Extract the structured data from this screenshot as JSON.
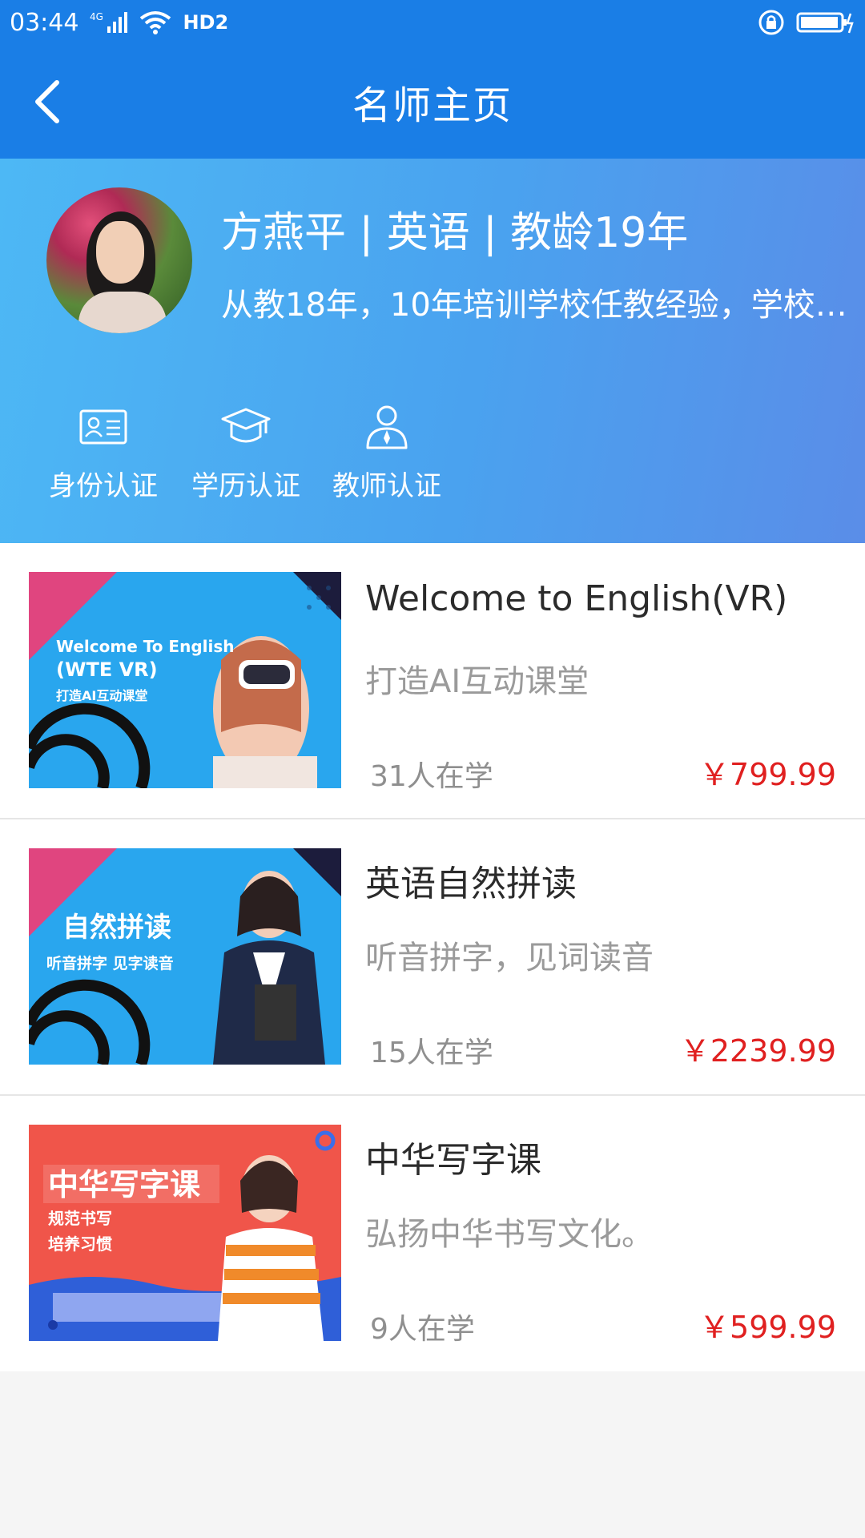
{
  "status_bar": {
    "time": "03:44",
    "network": "4G",
    "hd": "HD2"
  },
  "nav": {
    "title": "名师主页"
  },
  "teacher": {
    "name_line": "方燕平 | 英语 | 教龄19年",
    "bio": "从教18年，10年培训学校任教经验，学校…",
    "certs": [
      {
        "label": "身份认证",
        "icon": "id-card-icon"
      },
      {
        "label": "学历认证",
        "icon": "graduation-cap-icon"
      },
      {
        "label": "教师认证",
        "icon": "teacher-icon"
      }
    ]
  },
  "courses": [
    {
      "title": "Welcome to English(VR)",
      "subtitle": "打造AI互动课堂",
      "students": "31人在学",
      "price": "￥799.99",
      "thumb_lines": [
        "Welcome To English",
        "(WTE VR)",
        "打造AI互动课堂"
      ]
    },
    {
      "title": "英语自然拼读",
      "subtitle": "听音拼字，见词读音",
      "students": "15人在学",
      "price": "￥2239.99",
      "thumb_lines": [
        "自然拼读",
        "听音拼字 见字读音"
      ]
    },
    {
      "title": "中华写字课",
      "subtitle": "弘扬中华书写文化。",
      "students": "9人在学",
      "price": "￥599.99",
      "thumb_lines": [
        "中华写字课",
        "规范书写",
        "培养习惯"
      ]
    }
  ],
  "colors": {
    "primary": "#1a7ee6",
    "price": "#e02020",
    "banner_start": "#4db8f5",
    "banner_end": "#5a8de8"
  }
}
